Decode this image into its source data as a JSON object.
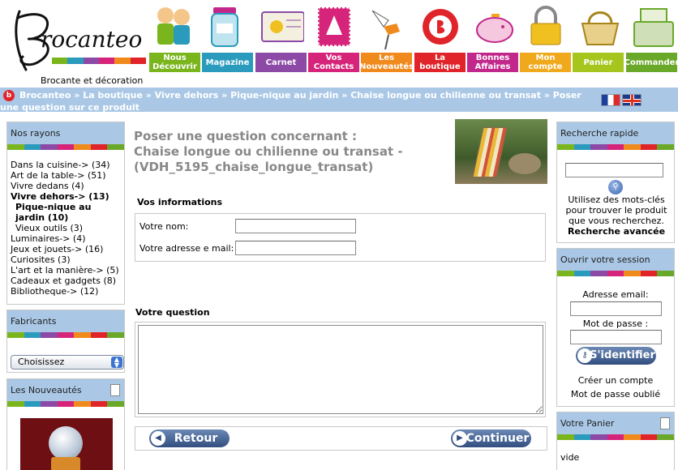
{
  "site": {
    "brand": "Brocanteo",
    "tagline": "Brocante et décoration"
  },
  "nav": [
    {
      "label": "Nous Découvrir",
      "color": "#7ab51d",
      "icon": "children-icon"
    },
    {
      "label": "Magazine",
      "color": "#2b9bbd",
      "icon": "jar-icon"
    },
    {
      "label": "Carnet",
      "color": "#8c4aa6",
      "icon": "notebook-icon"
    },
    {
      "label": "Vos Contacts",
      "color": "#d6247a",
      "icon": "stamp-icon"
    },
    {
      "label": "Les Nouveautés",
      "color": "#f08a1c",
      "icon": "stork-icon"
    },
    {
      "label": "La boutique",
      "color": "#e0242a",
      "icon": "boutique-logo-icon"
    },
    {
      "label": "Bonnes Affaires",
      "color": "#c2288c",
      "icon": "piggy-bank-icon"
    },
    {
      "label": "Mon compte",
      "color": "#f0a91c",
      "icon": "padlock-icon"
    },
    {
      "label": "Panier",
      "color": "#a6c51d",
      "icon": "basket-icon"
    },
    {
      "label": "Commander",
      "color": "#6aa82a",
      "icon": "cash-register-icon"
    }
  ],
  "stripe_colors": [
    "#7ab51d",
    "#2b9bbd",
    "#8c4aa6",
    "#d6247a",
    "#f08a1c",
    "#e0242a",
    "#6aa82a"
  ],
  "breadcrumb": {
    "items": [
      "Brocanteo",
      "La boutique",
      "Vivre dehors",
      "Pique-nique au jardin",
      "Chaise longue ou chilienne ou transat",
      "Poser une question sur ce produit"
    ],
    "separator": " » "
  },
  "languages": [
    "Français",
    "English"
  ],
  "left": {
    "rayons": {
      "title": "Nos rayons",
      "items": [
        {
          "text": "Dans la cuisine-> (34)",
          "bold": false,
          "sub": false
        },
        {
          "text": "Art de la table-> (51)",
          "bold": false,
          "sub": false
        },
        {
          "text": "Vivre dedans (4)",
          "bold": false,
          "sub": false
        },
        {
          "text": "Vivre dehors-> (13)",
          "bold": true,
          "sub": false
        },
        {
          "text": "Pique-nique au jardin (10)",
          "bold": true,
          "sub": true
        },
        {
          "text": "Vieux outils (3)",
          "bold": false,
          "sub": true
        },
        {
          "text": "Luminaires-> (4)",
          "bold": false,
          "sub": false
        },
        {
          "text": "Jeux et jouets-> (16)",
          "bold": false,
          "sub": false
        },
        {
          "text": "Curiosites (3)",
          "bold": false,
          "sub": false
        },
        {
          "text": "L'art et la manière-> (5)",
          "bold": false,
          "sub": false
        },
        {
          "text": "Cadeaux et gadgets (8)",
          "bold": false,
          "sub": false
        },
        {
          "text": "Bibliotheque-> (12)",
          "bold": false,
          "sub": false
        }
      ]
    },
    "fabricants": {
      "title": "Fabricants",
      "select_value": "Choisissez"
    },
    "nouveautes": {
      "title": "Les Nouveautés"
    }
  },
  "main": {
    "title_line1": "Poser une question concernant :",
    "title_line2": "Chaise longue ou chilienne ou transat -",
    "title_line3": "(VDH_5195_chaise_longue_transat)",
    "info_heading": "Vos informations",
    "name_label": "Votre nom:",
    "name_value": "",
    "email_label": "Votre adresse e mail:",
    "email_value": "",
    "question_heading": "Votre question",
    "question_value": "",
    "back_label": "Retour",
    "continue_label": "Continuer"
  },
  "right": {
    "search": {
      "title": "Recherche rapide",
      "input_value": "",
      "help": "Utilisez des mots-clés pour trouver le produit que vous recherchez.",
      "advanced": "Recherche avancée"
    },
    "session": {
      "title": "Ouvrir votre session",
      "email_label": "Adresse email:",
      "password_label": "Mot de passe :",
      "login_label": "S'identifier",
      "create_account": "Créer un compte",
      "forgot_password": "Mot de passe oublié"
    },
    "cart": {
      "title": "Votre Panier",
      "status": "vide"
    }
  }
}
